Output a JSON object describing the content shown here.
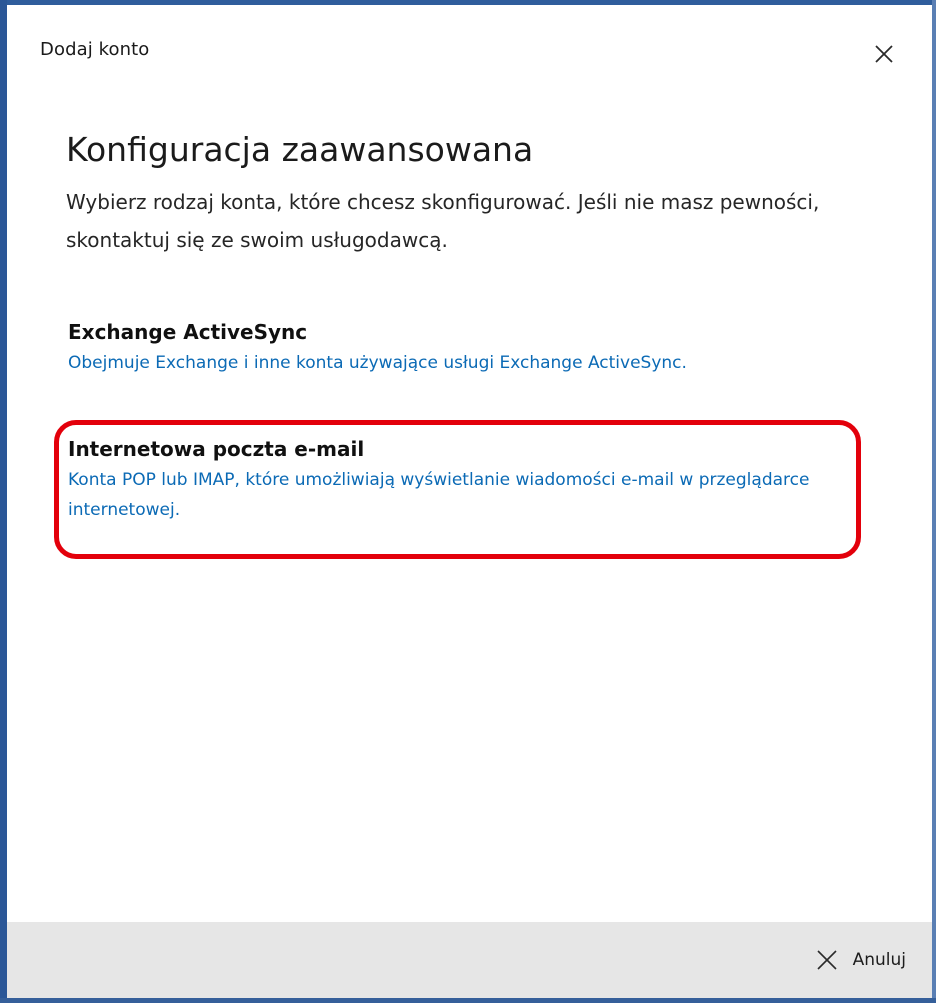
{
  "window": {
    "title": "Dodaj konto",
    "close_icon": "close-icon",
    "frame_color": "#2b5797"
  },
  "main": {
    "heading": "Konfiguracja zaawansowana",
    "description": "Wybierz rodzaj konta, które chcesz skonfigurować. Jeśli nie masz pewności, skontaktuj się ze swoim usługodawcą.",
    "options": [
      {
        "title": "Exchange ActiveSync",
        "description": "Obejmuje Exchange i inne konta używające usługi Exchange ActiveSync."
      },
      {
        "title": "Internetowa poczta e-mail",
        "description": "Konta POP lub IMAP, które umożliwiają wyświetlanie wiadomości e-mail w przeglądarce internetowej."
      }
    ],
    "link_color": "#0b6ab5",
    "highlight_color": "#e3000b"
  },
  "footer": {
    "cancel_label": "Anuluj",
    "cancel_icon": "close-icon"
  }
}
